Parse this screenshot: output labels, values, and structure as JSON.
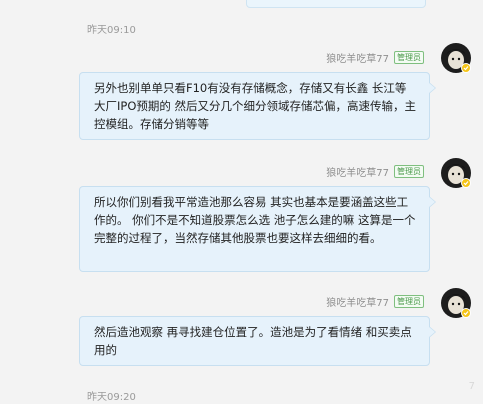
{
  "messages": [
    {
      "time": "昨天09:10",
      "sender": "狼吃羊吃草77",
      "badge": "管理员",
      "text": "另外也别单单只看F10有没有存储概念，存储又有长鑫 长江等大厂IPO预期的 然后又分几个细分领域存储芯偏，高速传输，主控模组。存储分销等等"
    },
    {
      "sender": "狼吃羊吃草77",
      "badge": "管理员",
      "text": "所以你们别看我平常造池那么容易 其实也基本是要涵盖这些工作的。 你们不是不知道股票怎么选 池子怎么建的嘛 这算是一个完整的过程了，当然存储其他股票也要这样去细细的看。"
    },
    {
      "sender": "狼吃羊吃草77",
      "badge": "管理员",
      "text": "然后造池观察 再寻找建仓位置了。造池是为了看情绪 和买卖点用的"
    }
  ],
  "footer_time": "昨天09:20",
  "watermark": "7"
}
